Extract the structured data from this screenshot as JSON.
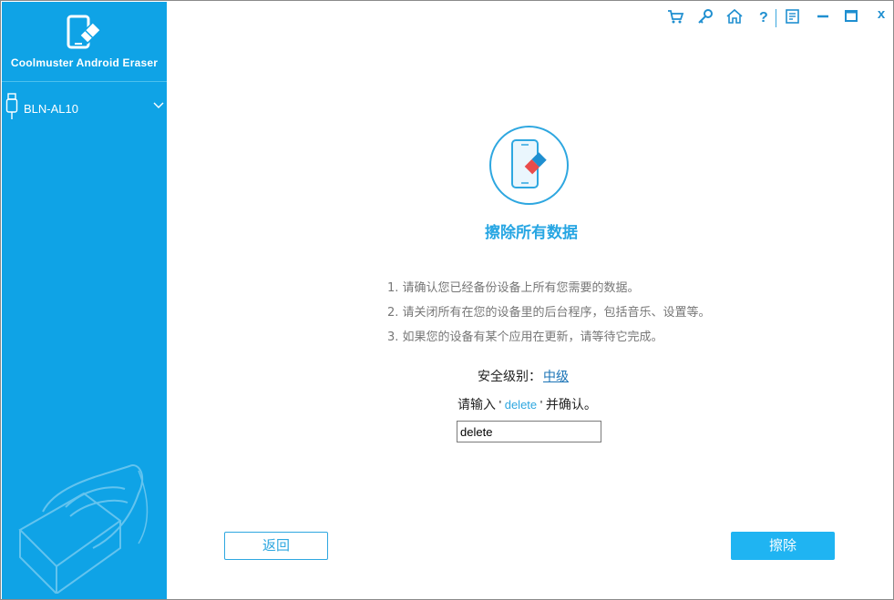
{
  "app": {
    "name": "Coolmuster Android Eraser"
  },
  "sidebar": {
    "device_name": "BLN-AL10"
  },
  "titlebar": {
    "icons": [
      "cart-icon",
      "key-icon",
      "home-icon",
      "help-icon",
      "feedback-icon",
      "minimize-icon",
      "maximize-icon",
      "close-icon"
    ],
    "close_label": "x"
  },
  "main": {
    "title": "擦除所有数据",
    "steps": [
      "1. 请确认您已经备份设备上所有您需要的数据。",
      "2. 请关闭所有在您的设备里的后台程序，包括音乐、设置等。",
      "3. 如果您的设备有某个应用在更新，请等待它完成。"
    ],
    "security_label": "安全级别：",
    "security_level": "中级",
    "confirm_prefix": "请输入",
    "confirm_quote_open": " ' ",
    "confirm_keyword": "delete",
    "confirm_quote_close": " ' ",
    "confirm_suffix": "并确认。",
    "confirm_input_value": "delete"
  },
  "buttons": {
    "back_label": "返回",
    "erase_label": "擦除"
  },
  "colors": {
    "sidebar_bg": "#0fa3e6",
    "accent": "#27a6e3",
    "link": "#1a73b6",
    "primary_button": "#1fb4f2"
  }
}
